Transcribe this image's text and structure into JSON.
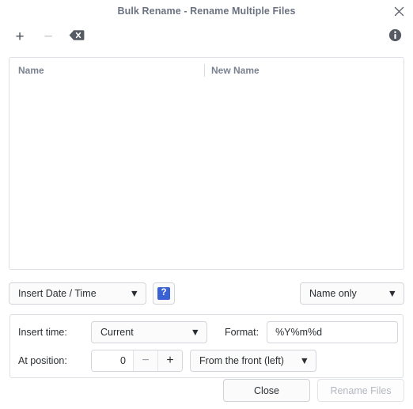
{
  "window": {
    "title": "Bulk Rename - Rename Multiple Files",
    "close_icon": "close-icon"
  },
  "toolbar": {
    "add_label": "+",
    "remove_label": "−",
    "clear_icon": "clear-all-icon",
    "info_icon": "info-icon"
  },
  "file_list": {
    "columns": [
      {
        "label": "Name"
      },
      {
        "label": "New Name"
      }
    ],
    "rows": []
  },
  "criteria": {
    "pattern": {
      "value": "Insert Date / Time",
      "caret": "▼"
    },
    "help": {
      "label": "?"
    },
    "scope": {
      "value": "Name only",
      "caret": "▼"
    }
  },
  "options": {
    "insert_time_label": "Insert time:",
    "insert_time": {
      "value": "Current",
      "caret": "▼"
    },
    "format_label": "Format:",
    "format": {
      "value": "%Y%m%d",
      "placeholder": "%Y%m%d"
    },
    "at_position_label": "At position:",
    "position": {
      "value": "0",
      "decrement_label": "−",
      "increment_label": "+"
    },
    "direction": {
      "value": "From the front (left)",
      "caret": "▼"
    }
  },
  "actions": {
    "close_label": "Close",
    "rename_label": "Rename Files"
  },
  "colors": {
    "title": "#6b7280",
    "accent_help": "#3b62d4",
    "border": "#dcdfe3",
    "text": "#2b2f33",
    "disabled_text": "#b4b8bf"
  }
}
